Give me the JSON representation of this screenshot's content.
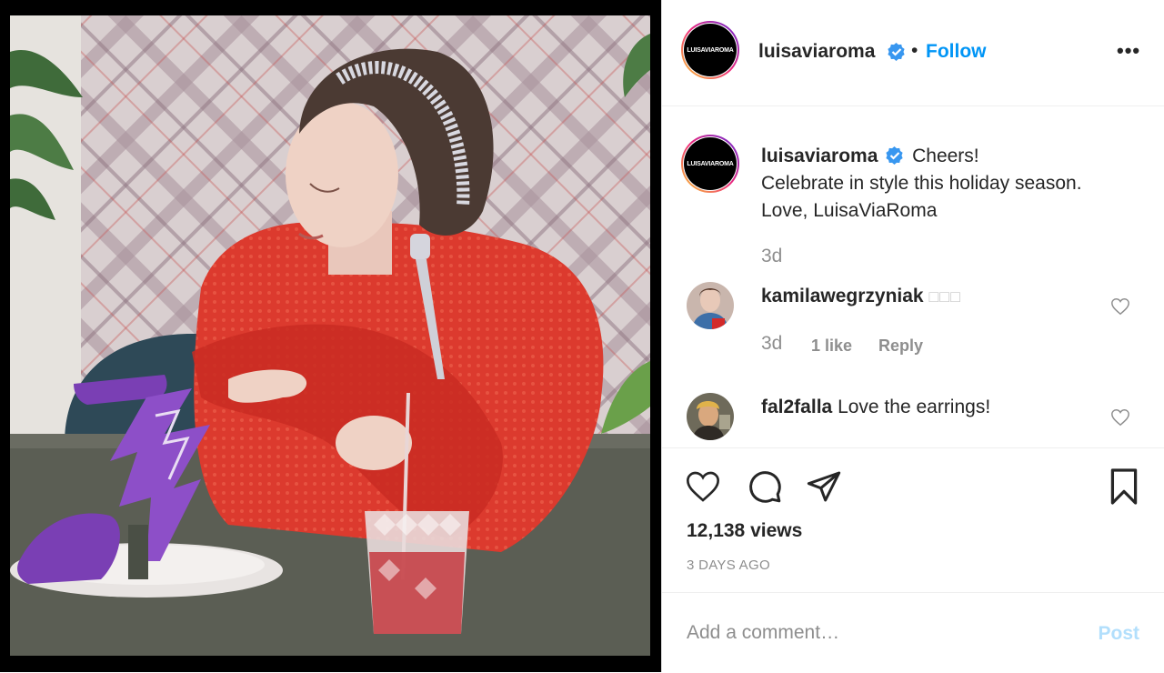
{
  "header": {
    "avatar_text": "LUISAVIAROMA",
    "username": "luisaviaroma",
    "dot": "•",
    "follow_label": "Follow",
    "more_label": "•••"
  },
  "caption": {
    "avatar_text": "LUISAVIAROMA",
    "username": "luisaviaroma",
    "line1": "Cheers!",
    "line2": "Celebrate in style this holiday season.",
    "line3": "Love, LuisaViaRoma",
    "time": "3d"
  },
  "comments": [
    {
      "username": "kamilawegrzyniak",
      "text": "□□□",
      "time": "3d",
      "likes": "1 like",
      "reply_label": "Reply"
    },
    {
      "username": "fal2falla",
      "text": "Love the earrings!"
    }
  ],
  "stats": {
    "views": "12,138 views",
    "posted": "3 DAYS AGO"
  },
  "add_comment": {
    "placeholder": "Add a comment…",
    "post_label": "Post"
  },
  "icons": {
    "verified": "verified-badge-icon",
    "heart": "heart-icon",
    "comment": "comment-icon",
    "share": "share-icon",
    "save": "bookmark-icon",
    "more": "more-options-icon"
  },
  "colors": {
    "accent_blue": "#0095f6",
    "post_disabled": "#b2dffc",
    "secondary_text": "#8e8e8e"
  }
}
